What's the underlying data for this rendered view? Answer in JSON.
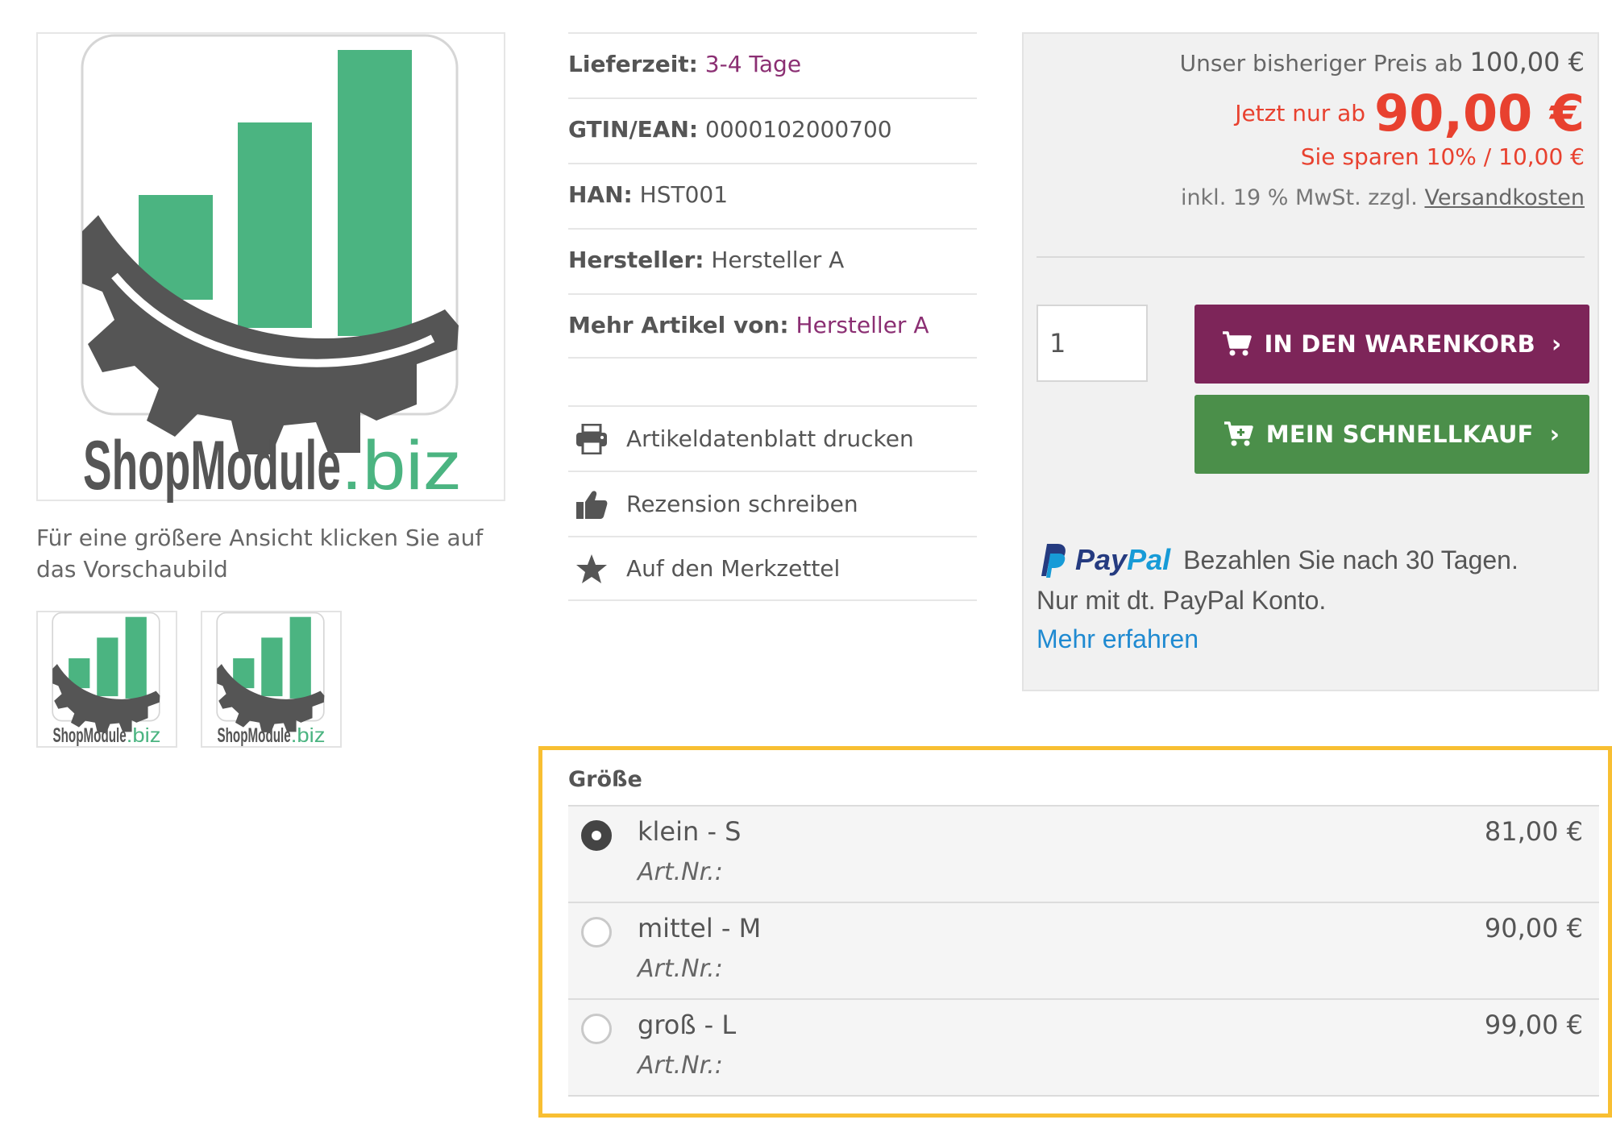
{
  "gallery": {
    "logo_text_main": "ShopModule",
    "logo_text_tld": ".biz",
    "hint": "Für eine größere Ansicht klicken Sie auf das Vorschaubild",
    "colors": {
      "bar_green": "#4bb481",
      "gear_gray": "#555555",
      "tld_green": "#4bb481"
    }
  },
  "details": [
    {
      "label": "Lieferzeit:",
      "value": "3-4 Tage",
      "is_link": true
    },
    {
      "label": "GTIN/EAN:",
      "value": "0000102000700",
      "is_link": false
    },
    {
      "label": "HAN:",
      "value": "HST001",
      "is_link": false
    },
    {
      "label": "Hersteller:",
      "value": "Hersteller A",
      "is_link": false
    },
    {
      "label": "Mehr Artikel von:",
      "value": "Hersteller A",
      "is_link": true
    }
  ],
  "actions": [
    {
      "icon": "printer-icon",
      "label": "Artikeldatenblatt drucken"
    },
    {
      "icon": "thumbs-up-icon",
      "label": "Rezension schreiben"
    },
    {
      "icon": "star-icon",
      "label": "Auf den Merkzettel"
    }
  ],
  "price": {
    "old_label": "Unser bisheriger Preis ab",
    "old_amount": "100,00 €",
    "new_label": "Jetzt nur ab",
    "new_amount": "90,00 €",
    "savings": "Sie sparen 10% / 10,00 €",
    "tax_text": "inkl. 19 % MwSt. zzgl.",
    "shipping_link": "Versandkosten",
    "colors": {
      "sale_red": "#e8412f"
    }
  },
  "cart": {
    "quantity": "1",
    "add_to_cart": "IN DEN WARENKORB",
    "quick_buy": "MEIN SCHNELLKAUF",
    "colors": {
      "cart_button": "#7d2559",
      "quick_button": "#4b8f4a"
    }
  },
  "paypal": {
    "brand_pay": "Pay",
    "brand_pal": "Pal",
    "line1": "Bezahlen Sie nach 30 Tagen.",
    "line2": "Nur mit dt. PayPal Konto.",
    "more_link": "Mehr erfahren"
  },
  "variants": {
    "title": "Größe",
    "highlight_color": "#f8bf32",
    "options": [
      {
        "name": "klein - S",
        "sku": "Art.Nr.:",
        "price": "81,00 €",
        "selected": true
      },
      {
        "name": "mittel - M",
        "sku": "Art.Nr.:",
        "price": "90,00 €",
        "selected": false
      },
      {
        "name": "groß - L",
        "sku": "Art.Nr.:",
        "price": "99,00 €",
        "selected": false
      }
    ]
  }
}
